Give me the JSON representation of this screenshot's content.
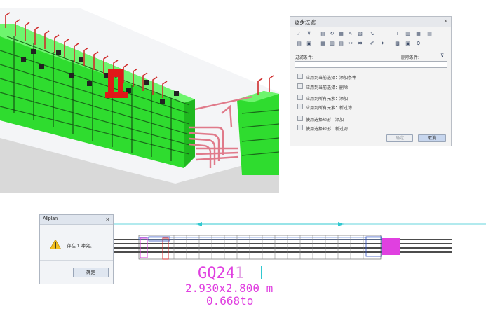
{
  "filter_dialog": {
    "title": "逐步过滤",
    "filter_label": "过滤条件:",
    "delete_label": "删除条件:",
    "filter_value": "",
    "options": [
      "应用到当前选择：添加条件",
      "应用到当前选择：删除",
      "应用到所有元素：添加",
      "应用到所有元素：新过滤",
      "使用选择矩形：添加",
      "使用选择矩形：新过滤"
    ],
    "ok_label": "确定",
    "cancel_label": "取消"
  },
  "allplan_dialog": {
    "title": "Allplan",
    "message": "存在 1 冲突。",
    "ok_label": "确定"
  },
  "cad": {
    "label_main": "GQ24",
    "label_suffix": "1",
    "dimensions": "2.930x2.800 m",
    "weight": "0.668to"
  },
  "colors": {
    "concrete": "#33ee33",
    "rebar": "#e03030",
    "magenta": "#e040e0",
    "cyan": "#30c8d0"
  }
}
